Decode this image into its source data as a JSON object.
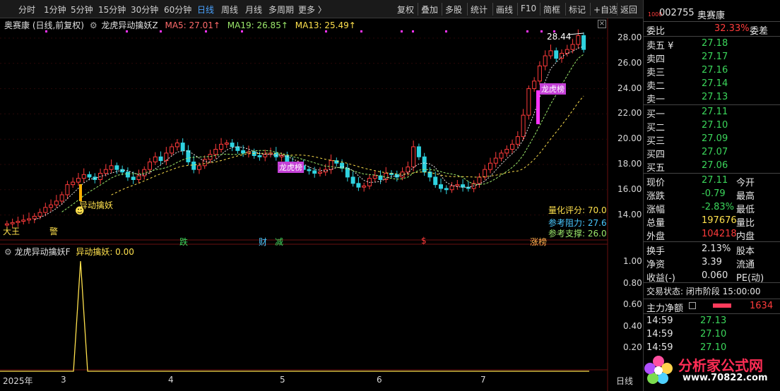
{
  "toolbar": {
    "periods": [
      "分时",
      "1分钟",
      "5分钟",
      "15分钟",
      "30分钟",
      "60分钟",
      "日线",
      "周线",
      "月线",
      "多周期",
      "更多 〉"
    ],
    "active_index": 6,
    "actions": [
      "复权",
      "叠加",
      "多股",
      "统计",
      "画线",
      "F10",
      "简框",
      "标记",
      "+自选",
      "返回"
    ]
  },
  "main_legend": {
    "stock_label": "奥赛康 (日线,前复权)",
    "indicator_name": "龙虎异动擒妖Z",
    "ma5": "MA5: 27.01↑",
    "ma19": "MA19: 26.85↑",
    "ma13": "MA13: 25.49↑"
  },
  "sub_legend": {
    "name": "龙虎异动擒妖F",
    "value": "异动擒妖: 0.00"
  },
  "price_axis": [
    "28.00",
    "26.00",
    "24.00",
    "22.00",
    "20.00",
    "18.00",
    "16.00",
    "14.00"
  ],
  "sub_axis": [
    "1.00",
    "0.80",
    "0.60",
    "0.40",
    "0.20"
  ],
  "date_axis": [
    "2025年",
    "3",
    "4",
    "5",
    "6",
    "7"
  ],
  "date_axis_label": "日线",
  "max_price_label": "28.44",
  "annotations": {
    "yidong": "异动擒妖",
    "dahe": "大王",
    "jing": "警",
    "die": "跌",
    "cai": "财",
    "jian": "减",
    "dollar": "$",
    "zhangbang": "涨榜",
    "longhu1": "龙虎榜",
    "longhu2": "龙虎榜"
  },
  "score": {
    "rating": "量化评分: 70.0",
    "resistance": "参考阻力: 27.6",
    "support": "参考支撑: 26.0"
  },
  "quote": {
    "code": "002755",
    "name": "奥赛康",
    "weibi_label": "委比",
    "weibi": "32.33%",
    "weicha_label": "委差",
    "asks": [
      {
        "label": "卖五 ¥",
        "price": "27.18"
      },
      {
        "label": "卖四",
        "price": "27.17"
      },
      {
        "label": "卖三",
        "price": "27.16"
      },
      {
        "label": "卖二",
        "price": "27.14"
      },
      {
        "label": "卖一",
        "price": "27.13"
      }
    ],
    "bids": [
      {
        "label": "买一",
        "price": "27.11"
      },
      {
        "label": "买二",
        "price": "27.10"
      },
      {
        "label": "买三",
        "price": "27.09"
      },
      {
        "label": "买四",
        "price": "27.07"
      },
      {
        "label": "买五",
        "price": "27.06"
      }
    ],
    "stats": [
      {
        "l": "现价",
        "v": "27.11",
        "r": "今开",
        "c": "green"
      },
      {
        "l": "涨跌",
        "v": "-0.79",
        "r": "最高",
        "c": "green"
      },
      {
        "l": "涨幅",
        "v": "-2.83%",
        "r": "最低",
        "c": "green"
      },
      {
        "l": "总量",
        "v": "197676",
        "r": "量比",
        "c": "yellow"
      },
      {
        "l": "外盘",
        "v": "104218",
        "r": "内盘",
        "c": "red"
      }
    ],
    "stats2": [
      {
        "l": "换手",
        "v": "2.13%",
        "r": "股本"
      },
      {
        "l": "净资",
        "v": "3.39",
        "r": "流通"
      },
      {
        "l": "收益(-)",
        "v": "0.060",
        "r": "PE(动)"
      }
    ],
    "status_label": "交易状态: 闭市阶段 15:00:00",
    "mainflow_label": "主力净额",
    "mainflow_value": "1634",
    "ticks": [
      {
        "t": "14:59",
        "p": "27.13"
      },
      {
        "t": "14:59",
        "p": "27.10"
      },
      {
        "t": "14:59",
        "p": "27.10"
      }
    ]
  },
  "logo": {
    "title": "分析家公式网",
    "url": "www.70822.com"
  },
  "colors": {
    "up": "#ff3b3b",
    "down": "#2fd3e0",
    "ma5": "#ffffff",
    "ma19": "#ffe14d",
    "ma13": "#ff66cc",
    "accent": "#4aa3ff",
    "magenta": "#ff33ff"
  }
}
